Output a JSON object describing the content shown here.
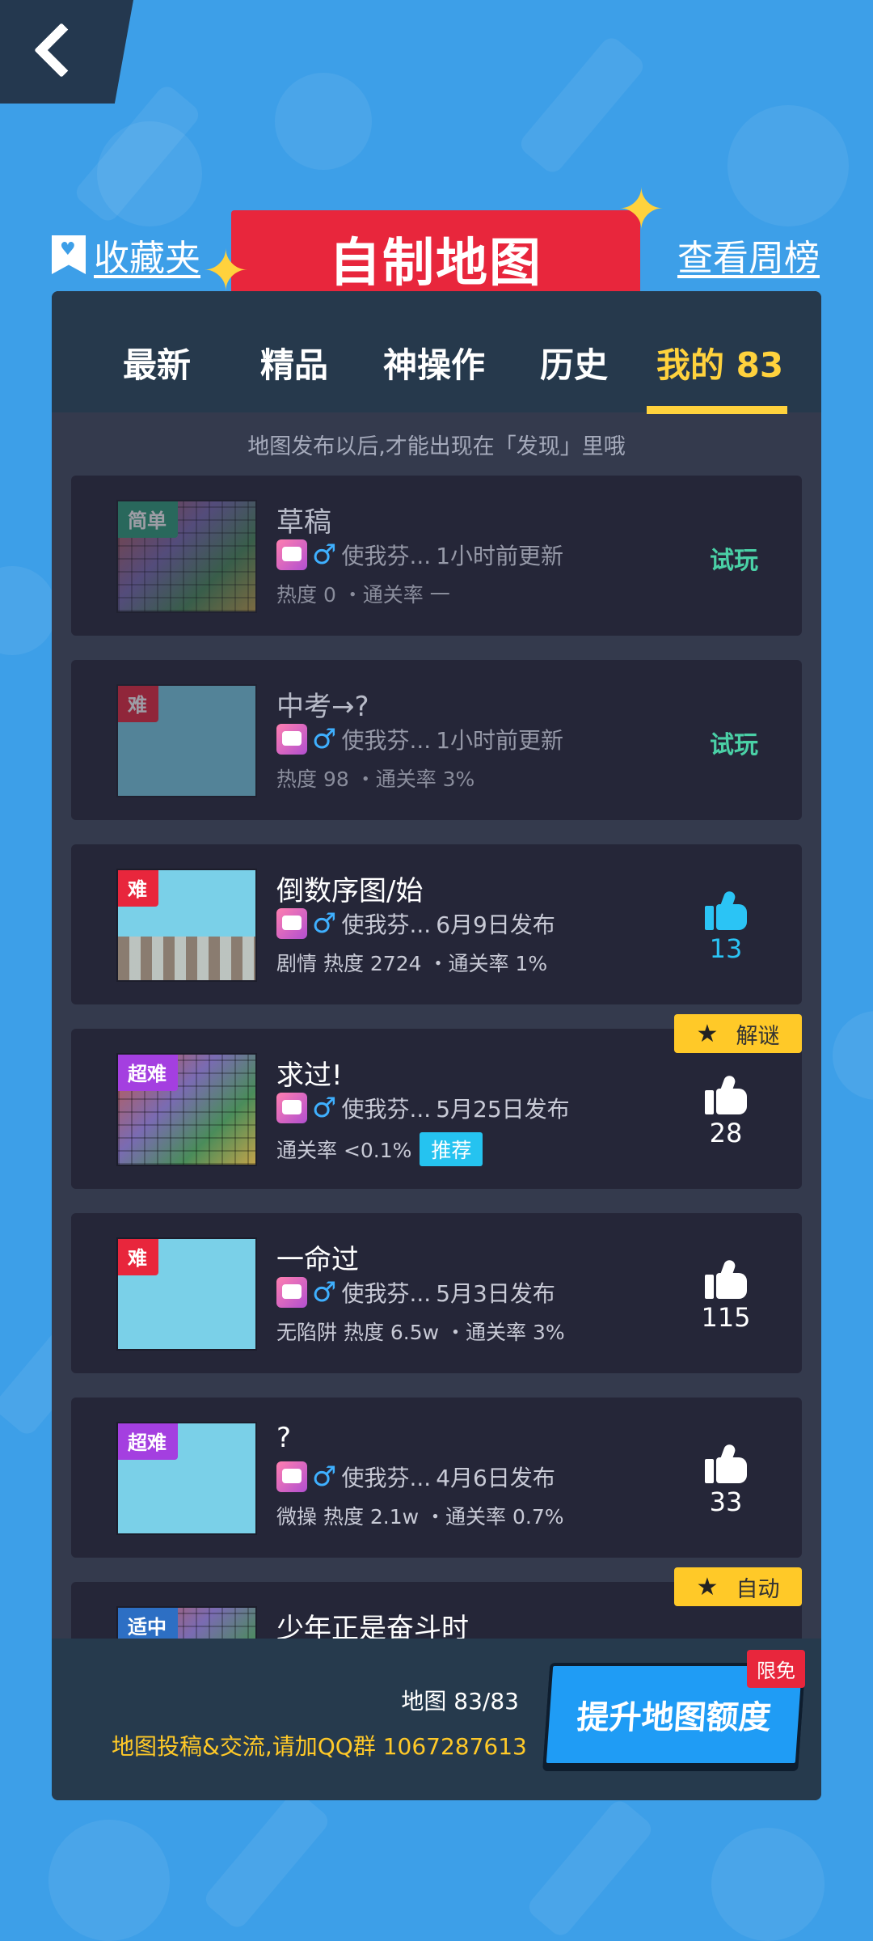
{
  "header": {
    "favorites_label": "收藏夹",
    "title": "自制地图",
    "weekly_label": "查看周榜"
  },
  "tabs": [
    {
      "label": "最新"
    },
    {
      "label": "精品"
    },
    {
      "label": "神操作"
    },
    {
      "label": "历史"
    },
    {
      "label": "我的 83",
      "active": true
    }
  ],
  "notice": "地图发布以后,才能出现在「发现」里哦",
  "maps": [
    {
      "difficulty": "简单",
      "difficulty_color": "#2e9f7a",
      "title": "草稿",
      "author": "使我芬...",
      "time": "1小时前更新",
      "stats": "热度 0 ・通关率 一",
      "action": "试玩",
      "draft": true
    },
    {
      "difficulty": "难",
      "difficulty_color": "#e8263c",
      "title": "中考→?",
      "author": "使我芬...",
      "time": "1小时前更新",
      "stats": "热度 98 ・通关率 3%",
      "action": "试玩",
      "draft": true
    },
    {
      "difficulty": "难",
      "difficulty_color": "#e8263c",
      "title": "倒数序图/始",
      "author": "使我芬...",
      "time": "6月9日发布",
      "stats": "剧情 热度 2724 ・通关率 1%",
      "likes": "13",
      "liked": true
    },
    {
      "difficulty": "超难",
      "difficulty_color": "#a43fe0",
      "title": "求过!",
      "author": "使我芬...",
      "time": "5月25日发布",
      "stats": "通关率 <0.1%",
      "recommend": "推荐",
      "likes": "28",
      "tag": "解谜"
    },
    {
      "difficulty": "难",
      "difficulty_color": "#e8263c",
      "title": "一命过",
      "author": "使我芬...",
      "time": "5月3日发布",
      "stats": "无陷阱 热度 6.5w ・通关率 3%",
      "likes": "115"
    },
    {
      "difficulty": "超难",
      "difficulty_color": "#a43fe0",
      "title": "?",
      "author": "使我芬...",
      "time": "4月6日发布",
      "stats": "微操 热度 2.1w ・通关率 0.7%",
      "likes": "33"
    },
    {
      "difficulty": "适中",
      "difficulty_color": "#2d6fc4",
      "title": "少年正是奋斗时",
      "tag": "自动"
    }
  ],
  "footer": {
    "quota": "地图 83/83",
    "qq_notice": "地图投稿&交流,请加QQ群 1067287613",
    "upgrade_label": "提升地图额度",
    "limit_badge": "限免"
  },
  "colors": {
    "background": "#3d9fe8",
    "ribbon": "#e8263c",
    "accent": "#ffd23d",
    "panel": "#343a4d",
    "card": "#252638"
  }
}
